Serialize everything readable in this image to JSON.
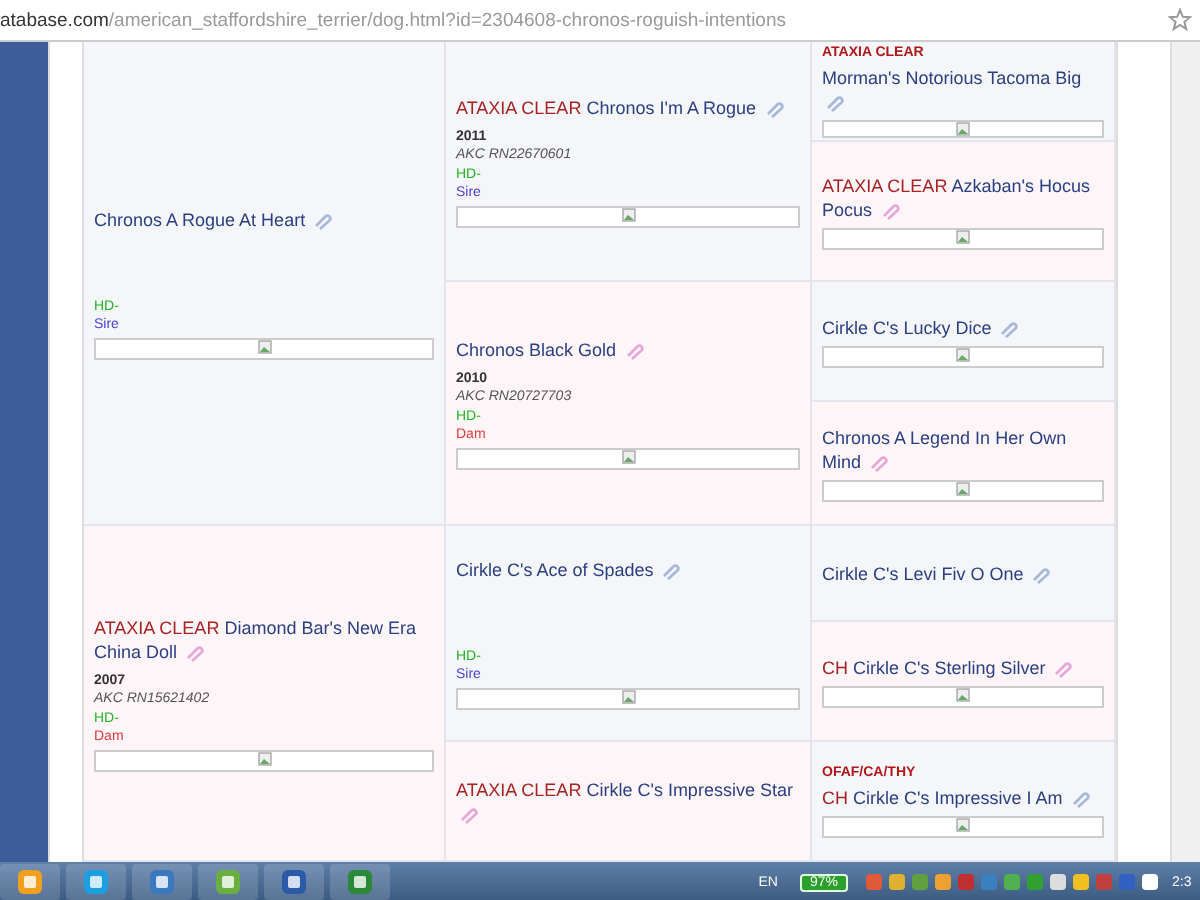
{
  "address_bar": {
    "host": "atabase.com",
    "path": "/american_staffordshire_terrier/dog.html?id=2304608-chronos-roguish-intentions"
  },
  "pedigree": {
    "columns": [
      [
        {
          "kind": "sire",
          "entries": {
            "name": "Chronos A Rogue At Heart",
            "female": false,
            "hd": "HD-",
            "role": "Sire",
            "photo": true
          }
        },
        {
          "kind": "dam",
          "entries": {
            "prefix": "ATAXIA CLEAR",
            "name": "Diamond Bar's New Era China Doll",
            "female": true,
            "year": "2007",
            "reg": "AKC RN15621402",
            "hd": "HD-",
            "role": "Dam",
            "photo": true
          }
        }
      ],
      [
        {
          "kind": "sire",
          "entries": {
            "prefix": "ATAXIA CLEAR",
            "name": "Chronos I'm A Rogue",
            "female": false,
            "year": "2011",
            "reg": "AKC RN22670601",
            "hd": "HD-",
            "role": "Sire",
            "photo": true
          }
        },
        {
          "kind": "dam",
          "entries": {
            "name": "Chronos Black Gold",
            "female": true,
            "year": "2010",
            "reg": "AKC RN20727703",
            "hd": "HD-",
            "role": "Dam",
            "photo": true
          }
        },
        {
          "kind": "sire",
          "entries": {
            "name": "Cirkle C's Ace of Spades",
            "female": false,
            "hd": "HD-",
            "role": "Sire",
            "photo": true
          }
        },
        {
          "kind": "dam",
          "entries": {
            "prefix": "ATAXIA CLEAR",
            "name": "Cirkle C's Impressive Star",
            "female": true
          }
        }
      ],
      [
        {
          "kind": "sire",
          "entries": {
            "health_tag": "ATAXIA CLEAR",
            "name": "Morman's Notorious Tacoma Big",
            "female": false,
            "photo": true
          }
        },
        {
          "kind": "dam",
          "entries": {
            "prefix": "ATAXIA CLEAR",
            "name": "Azkaban's Hocus Pocus",
            "female": true,
            "photo": true
          }
        },
        {
          "kind": "sire",
          "entries": {
            "name": "Cirkle C's Lucky Dice",
            "female": false,
            "photo": true
          }
        },
        {
          "kind": "dam",
          "entries": {
            "name": "Chronos A Legend In Her Own Mind",
            "female": true,
            "photo": true
          }
        },
        {
          "kind": "sire",
          "entries": {
            "name": "Cirkle C's Levi Fiv O One",
            "female": false
          }
        },
        {
          "kind": "dam",
          "entries": {
            "prefix": "CH",
            "name": "Cirkle C's Sterling Silver",
            "female": true,
            "photo": true
          }
        },
        {
          "kind": "sire",
          "entries": {
            "health_tag": "OFAF/CA/THY",
            "prefix": "CH",
            "name": "Cirkle C's Impressive I Am",
            "female": false,
            "photo": true
          }
        }
      ]
    ]
  },
  "taskbar": {
    "apps": [
      {
        "kind": "mail"
      },
      {
        "kind": "chat"
      },
      {
        "kind": "meeting"
      },
      {
        "kind": "people"
      },
      {
        "kind": "word"
      },
      {
        "kind": "sheet"
      }
    ],
    "language": "EN",
    "battery": "97%",
    "clock": "2:3"
  }
}
